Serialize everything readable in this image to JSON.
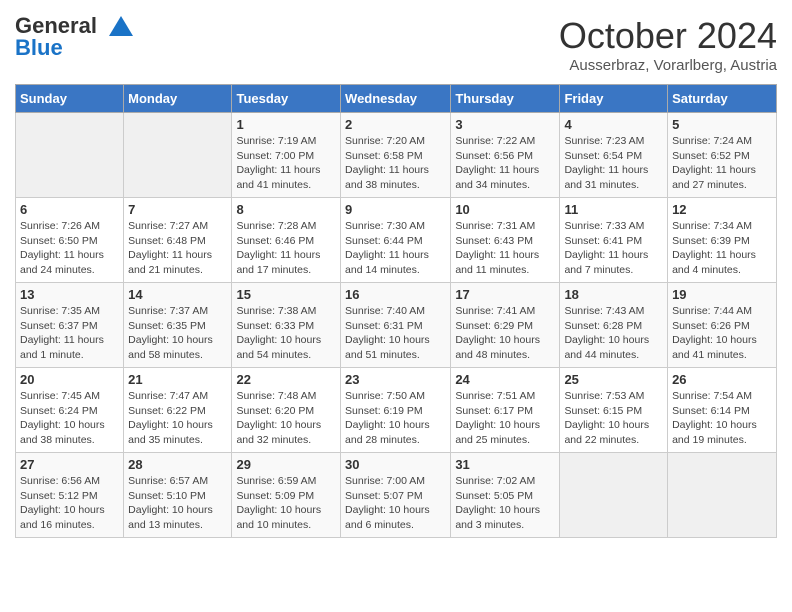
{
  "header": {
    "logo_line1": "General",
    "logo_line2": "Blue",
    "month_title": "October 2024",
    "subtitle": "Ausserbraz, Vorarlberg, Austria"
  },
  "days_of_week": [
    "Sunday",
    "Monday",
    "Tuesday",
    "Wednesday",
    "Thursday",
    "Friday",
    "Saturday"
  ],
  "weeks": [
    [
      {
        "num": "",
        "info": ""
      },
      {
        "num": "",
        "info": ""
      },
      {
        "num": "1",
        "info": "Sunrise: 7:19 AM\nSunset: 7:00 PM\nDaylight: 11 hours and 41 minutes."
      },
      {
        "num": "2",
        "info": "Sunrise: 7:20 AM\nSunset: 6:58 PM\nDaylight: 11 hours and 38 minutes."
      },
      {
        "num": "3",
        "info": "Sunrise: 7:22 AM\nSunset: 6:56 PM\nDaylight: 11 hours and 34 minutes."
      },
      {
        "num": "4",
        "info": "Sunrise: 7:23 AM\nSunset: 6:54 PM\nDaylight: 11 hours and 31 minutes."
      },
      {
        "num": "5",
        "info": "Sunrise: 7:24 AM\nSunset: 6:52 PM\nDaylight: 11 hours and 27 minutes."
      }
    ],
    [
      {
        "num": "6",
        "info": "Sunrise: 7:26 AM\nSunset: 6:50 PM\nDaylight: 11 hours and 24 minutes."
      },
      {
        "num": "7",
        "info": "Sunrise: 7:27 AM\nSunset: 6:48 PM\nDaylight: 11 hours and 21 minutes."
      },
      {
        "num": "8",
        "info": "Sunrise: 7:28 AM\nSunset: 6:46 PM\nDaylight: 11 hours and 17 minutes."
      },
      {
        "num": "9",
        "info": "Sunrise: 7:30 AM\nSunset: 6:44 PM\nDaylight: 11 hours and 14 minutes."
      },
      {
        "num": "10",
        "info": "Sunrise: 7:31 AM\nSunset: 6:43 PM\nDaylight: 11 hours and 11 minutes."
      },
      {
        "num": "11",
        "info": "Sunrise: 7:33 AM\nSunset: 6:41 PM\nDaylight: 11 hours and 7 minutes."
      },
      {
        "num": "12",
        "info": "Sunrise: 7:34 AM\nSunset: 6:39 PM\nDaylight: 11 hours and 4 minutes."
      }
    ],
    [
      {
        "num": "13",
        "info": "Sunrise: 7:35 AM\nSunset: 6:37 PM\nDaylight: 11 hours and 1 minute."
      },
      {
        "num": "14",
        "info": "Sunrise: 7:37 AM\nSunset: 6:35 PM\nDaylight: 10 hours and 58 minutes."
      },
      {
        "num": "15",
        "info": "Sunrise: 7:38 AM\nSunset: 6:33 PM\nDaylight: 10 hours and 54 minutes."
      },
      {
        "num": "16",
        "info": "Sunrise: 7:40 AM\nSunset: 6:31 PM\nDaylight: 10 hours and 51 minutes."
      },
      {
        "num": "17",
        "info": "Sunrise: 7:41 AM\nSunset: 6:29 PM\nDaylight: 10 hours and 48 minutes."
      },
      {
        "num": "18",
        "info": "Sunrise: 7:43 AM\nSunset: 6:28 PM\nDaylight: 10 hours and 44 minutes."
      },
      {
        "num": "19",
        "info": "Sunrise: 7:44 AM\nSunset: 6:26 PM\nDaylight: 10 hours and 41 minutes."
      }
    ],
    [
      {
        "num": "20",
        "info": "Sunrise: 7:45 AM\nSunset: 6:24 PM\nDaylight: 10 hours and 38 minutes."
      },
      {
        "num": "21",
        "info": "Sunrise: 7:47 AM\nSunset: 6:22 PM\nDaylight: 10 hours and 35 minutes."
      },
      {
        "num": "22",
        "info": "Sunrise: 7:48 AM\nSunset: 6:20 PM\nDaylight: 10 hours and 32 minutes."
      },
      {
        "num": "23",
        "info": "Sunrise: 7:50 AM\nSunset: 6:19 PM\nDaylight: 10 hours and 28 minutes."
      },
      {
        "num": "24",
        "info": "Sunrise: 7:51 AM\nSunset: 6:17 PM\nDaylight: 10 hours and 25 minutes."
      },
      {
        "num": "25",
        "info": "Sunrise: 7:53 AM\nSunset: 6:15 PM\nDaylight: 10 hours and 22 minutes."
      },
      {
        "num": "26",
        "info": "Sunrise: 7:54 AM\nSunset: 6:14 PM\nDaylight: 10 hours and 19 minutes."
      }
    ],
    [
      {
        "num": "27",
        "info": "Sunrise: 6:56 AM\nSunset: 5:12 PM\nDaylight: 10 hours and 16 minutes."
      },
      {
        "num": "28",
        "info": "Sunrise: 6:57 AM\nSunset: 5:10 PM\nDaylight: 10 hours and 13 minutes."
      },
      {
        "num": "29",
        "info": "Sunrise: 6:59 AM\nSunset: 5:09 PM\nDaylight: 10 hours and 10 minutes."
      },
      {
        "num": "30",
        "info": "Sunrise: 7:00 AM\nSunset: 5:07 PM\nDaylight: 10 hours and 6 minutes."
      },
      {
        "num": "31",
        "info": "Sunrise: 7:02 AM\nSunset: 5:05 PM\nDaylight: 10 hours and 3 minutes."
      },
      {
        "num": "",
        "info": ""
      },
      {
        "num": "",
        "info": ""
      }
    ]
  ]
}
